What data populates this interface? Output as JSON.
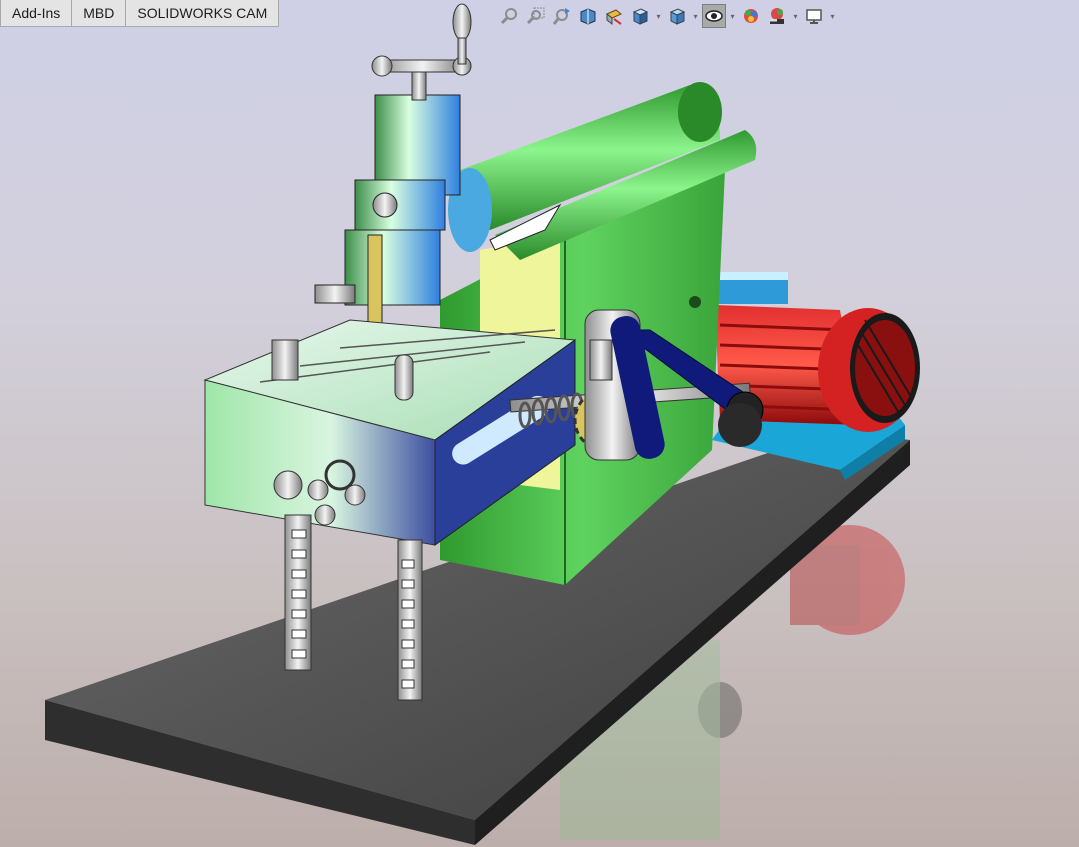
{
  "command_tabs": [
    {
      "label": "Add-Ins"
    },
    {
      "label": "MBD"
    },
    {
      "label": "SOLIDWORKS CAM"
    }
  ],
  "heads_up_toolbar": {
    "buttons": [
      {
        "icon": "zoom-to-fit-icon"
      },
      {
        "icon": "zoom-to-area-icon"
      },
      {
        "icon": "previous-view-icon"
      },
      {
        "icon": "section-view-icon"
      },
      {
        "icon": "dynamic-annotation-views-icon"
      },
      {
        "icon": "view-orientation-icon",
        "dropdown": true
      },
      {
        "icon": "display-style-icon",
        "dropdown": true
      },
      {
        "icon": "hide-show-items-icon",
        "dropdown": true,
        "active": true
      },
      {
        "icon": "edit-appearance-icon"
      },
      {
        "icon": "apply-scene-icon",
        "dropdown": true
      },
      {
        "icon": "view-settings-icon",
        "dropdown": true
      }
    ]
  },
  "model": {
    "description_visible": false
  }
}
